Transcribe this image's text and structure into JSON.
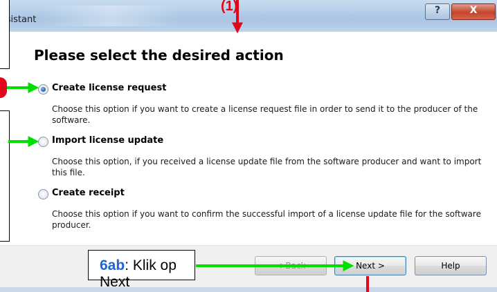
{
  "window": {
    "title": "ssistant",
    "help_glyph": "?",
    "close_glyph": "X"
  },
  "page": {
    "title": "Please select the desired action"
  },
  "options": [
    {
      "label": "Create license request",
      "description": "Choose this option if you want to create a license request file in order to send it to the producer of the software.",
      "selected": true
    },
    {
      "label": "Import license update",
      "description": "Choose this option, if you received a license update file from the software producer and want to import this file.",
      "selected": false
    },
    {
      "label": "Create receipt",
      "description": "Choose this option if you want to confirm the successful import of a license update file for the software producer.",
      "selected": false
    }
  ],
  "buttons": {
    "back": "< Back",
    "next": "Next >",
    "help": "Help"
  },
  "annotation": {
    "step_marker": "(1)",
    "callout_step": "6ab",
    "callout_text": ": Klik op Next",
    "arrow_red": "#e3061b",
    "arrow_green": "#00e000"
  }
}
